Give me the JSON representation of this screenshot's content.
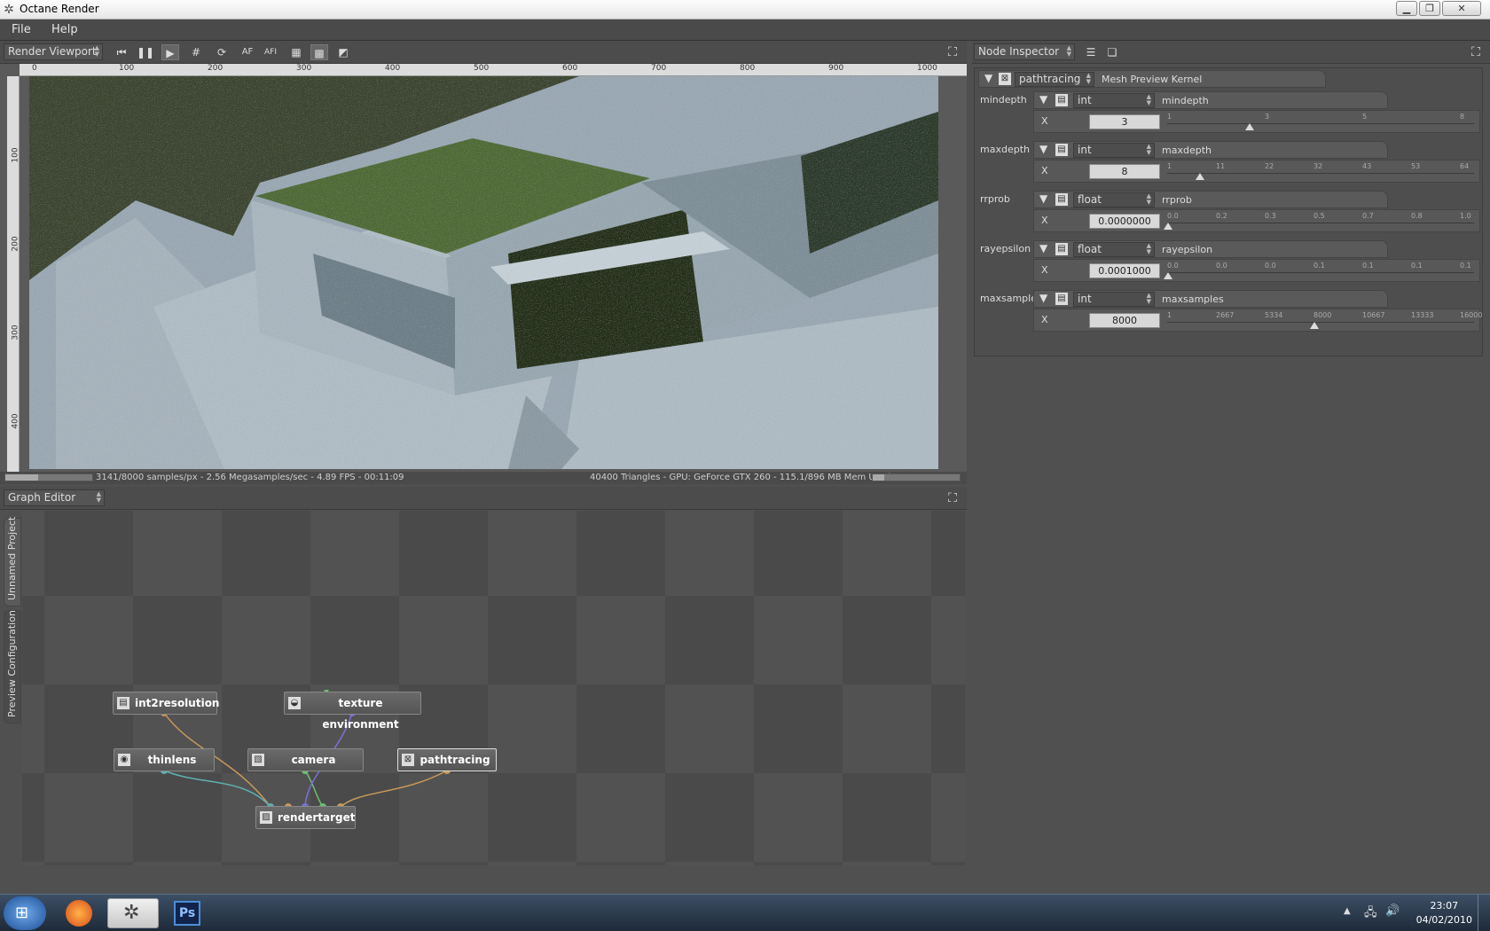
{
  "window": {
    "title": "Octane Render"
  },
  "menu": {
    "file": "File",
    "help": "Help"
  },
  "viewport": {
    "panel_title": "Render Viewport",
    "buttons": {
      "af": "AF",
      "afi": "AFI"
    },
    "ruler_top": [
      "0",
      "100",
      "200",
      "300",
      "400",
      "500",
      "600",
      "700",
      "800",
      "900",
      "1000"
    ],
    "ruler_left": [
      "100",
      "200",
      "300",
      "400"
    ],
    "status_left": "3141/8000 samples/px - 2.56 Megasamples/sec - 4.89 FPS - 00:11:09",
    "status_right": "40400 Triangles - GPU: GeForce GTX 260 - 115.1/896 MB Mem Used"
  },
  "graph_editor": {
    "panel_title": "Graph Editor",
    "tabs": [
      "Unnamed Project",
      "Preview Configuration"
    ],
    "nodes": {
      "int2resolution": "int2resolution",
      "texture_environment": "texture environment",
      "thinlens": "thinlens",
      "camera": "camera",
      "pathtracing": "pathtracing",
      "rendertarget": "rendertarget"
    }
  },
  "inspector": {
    "panel_title": "Node Inspector",
    "kernel_combo": "pathtracing",
    "kernel_label": "Mesh Preview Kernel",
    "axis_label": "X",
    "params": [
      {
        "name": "mindepth",
        "type": "int",
        "label": "mindepth",
        "value": "3",
        "ticks": [
          "1",
          "3",
          "5",
          "8"
        ],
        "position": 0.28
      },
      {
        "name": "maxdepth",
        "type": "int",
        "label": "maxdepth",
        "value": "8",
        "ticks": [
          "1",
          "11",
          "22",
          "32",
          "43",
          "53",
          "64"
        ],
        "position": 0.11
      },
      {
        "name": "rrprob",
        "type": "float",
        "label": "rrprob",
        "value": "0.0000000",
        "ticks": [
          "0.0",
          "0.2",
          "0.3",
          "0.5",
          "0.7",
          "0.8",
          "1.0"
        ],
        "position": 0.0
      },
      {
        "name": "rayepsilon",
        "type": "float",
        "label": "rayepsilon",
        "value": "0.0001000",
        "ticks": [
          "0.0",
          "0.0",
          "0.0",
          "0.1",
          "0.1",
          "0.1",
          "0.1"
        ],
        "position": 0.0
      },
      {
        "name": "maxsamples",
        "type": "int",
        "label": "maxsamples",
        "value": "8000",
        "ticks": [
          "1",
          "2667",
          "5334",
          "8000",
          "10667",
          "13333",
          "16000"
        ],
        "position": 0.5
      }
    ]
  },
  "taskbar": {
    "photoshop": "Ps",
    "time": "23:07",
    "date": "04/02/2010"
  },
  "colors": {
    "accent_link_orange": "#c79a5a",
    "link_teal": "#5fb0b0",
    "link_green": "#6cc070",
    "link_purple": "#7a72d8"
  }
}
